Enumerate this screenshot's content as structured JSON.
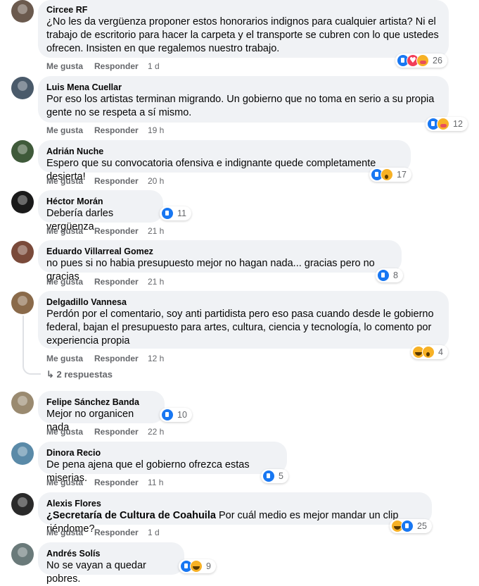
{
  "comments": [
    {
      "author": "Circee RF",
      "text": "¿No les da vergüenza proponer estos honorarios indignos para cualquier artista? Ni el trabajo de escritorio para hacer la carpeta y el transporte se cubren con lo que ustedes ofrecen. Insisten en que regalemos nuestro trabajo.",
      "like_label": "Me gusta",
      "reply_label": "Responder",
      "time": "1 d",
      "reactions": [
        "like-reaction-icon",
        "love-reaction-icon",
        "care-reaction-icon"
      ],
      "reaction_count": "26",
      "avatar_color": "#6b5a4e"
    },
    {
      "author": "Luis Mena Cuellar",
      "text": "Por eso los artistas terminan migrando. Un gobierno que no toma en serio a su propia gente no se respeta a sí mismo.",
      "like_label": "Me gusta",
      "reply_label": "Responder",
      "time": "19 h",
      "reactions": [
        "like-reaction-icon",
        "care-reaction-icon"
      ],
      "reaction_count": "12",
      "avatar_color": "#4a5a6a"
    },
    {
      "author": "Adrián Nuche",
      "text": "Espero que su convocatoria ofensiva e indignante quede completamente desierta!",
      "like_label": "Me gusta",
      "reply_label": "Responder",
      "time": "20 h",
      "reactions": [
        "like-reaction-icon",
        "wow-reaction-icon"
      ],
      "reaction_count": "17",
      "avatar_color": "#3f5a3a"
    },
    {
      "author": "Héctor Morán",
      "text": "Debería darles vergüenza",
      "like_label": "Me gusta",
      "reply_label": "Responder",
      "time": "21 h",
      "reactions": [
        "like-reaction-icon"
      ],
      "reaction_count": "11",
      "avatar_color": "#1a1a1a"
    },
    {
      "author": "Eduardo Villarreal Gomez",
      "text": "no pues si no habia presupuesto mejor no hagan nada... gracias pero no gracias",
      "like_label": "Me gusta",
      "reply_label": "Responder",
      "time": "21 h",
      "reactions": [
        "like-reaction-icon"
      ],
      "reaction_count": "8",
      "avatar_color": "#7a4a3a"
    },
    {
      "author": "Delgadillo Vannesa",
      "text": "Perdón por el comentario, soy anti partidista pero eso pasa cuando desde le gobierno federal, bajan el presupuesto para artes, cultura, ciencia y tecnología, lo comento por experiencia propia",
      "like_label": "Me gusta",
      "reply_label": "Responder",
      "time": "12 h",
      "reactions": [
        "haha-reaction-icon",
        "wow-reaction-icon"
      ],
      "reaction_count": "4",
      "avatar_color": "#8a6a4a"
    },
    {
      "author": "Felipe Sánchez Banda",
      "text": "Mejor no organicen nada",
      "like_label": "Me gusta",
      "reply_label": "Responder",
      "time": "22 h",
      "reactions": [
        "like-reaction-icon"
      ],
      "reaction_count": "10",
      "avatar_color": "#9a8a70"
    },
    {
      "author": "Dinora Recio",
      "text": "De pena ajena que el gobierno ofrezca estas miserias.",
      "like_label": "Me gusta",
      "reply_label": "Responder",
      "time": "11 h",
      "reactions": [
        "like-reaction-icon"
      ],
      "reaction_count": "5",
      "avatar_color": "#5a8aa8"
    },
    {
      "author": "Alexis Flores",
      "mention": "¿Secretaría de Cultura de Coahuila",
      "text": " Por cuál medio es mejor mandar un clip riéndome?",
      "like_label": "Me gusta",
      "reply_label": "Responder",
      "time": "1 d",
      "reactions": [
        "haha-reaction-icon",
        "like-reaction-icon"
      ],
      "reaction_count": "25",
      "avatar_color": "#2a2a2a"
    },
    {
      "author": "Andrés Solís",
      "text": "No se vayan a quedar pobres.",
      "like_label": "",
      "reply_label": "",
      "time": "",
      "reactions": [
        "like-reaction-icon",
        "haha-reaction-icon"
      ],
      "reaction_count": "9",
      "avatar_color": "#6a7a7a"
    }
  ],
  "replies_link": "↳ 2 respuestas"
}
